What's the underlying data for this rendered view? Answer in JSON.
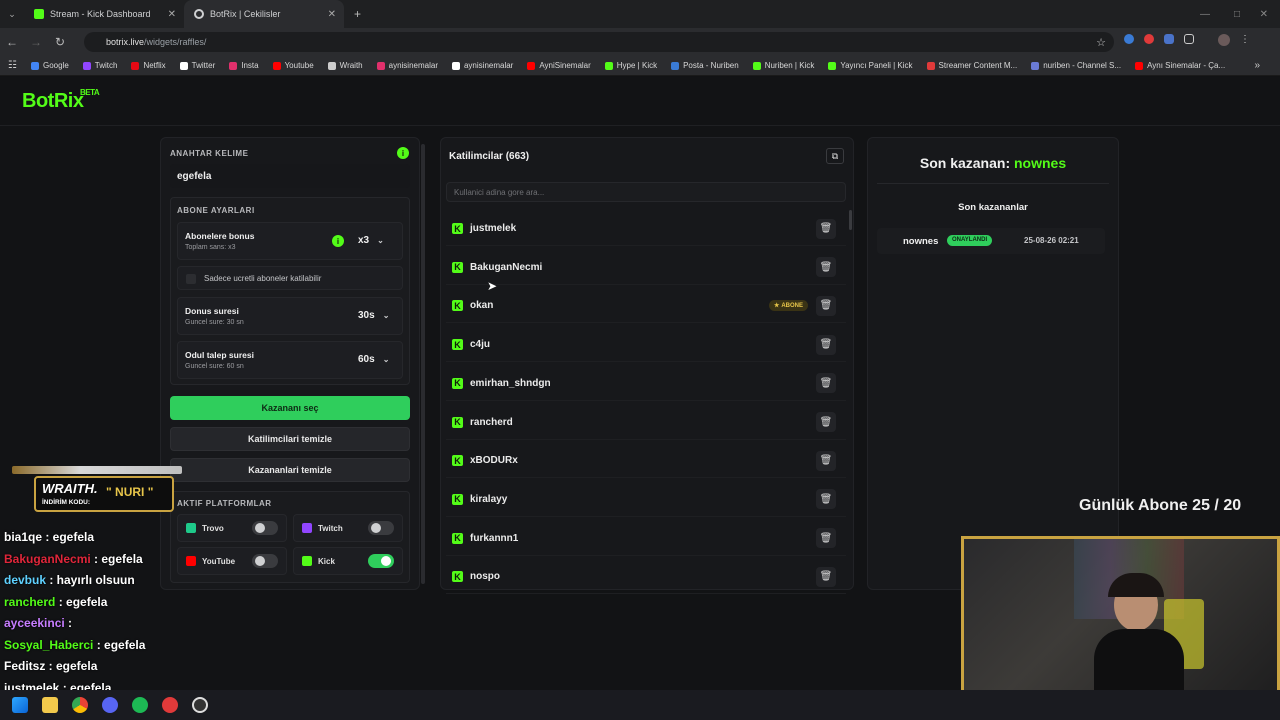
{
  "browser": {
    "tabs": [
      {
        "title": "Stream - Kick Dashboard",
        "active": false
      },
      {
        "title": "BotRix | Cekilisler",
        "active": true
      }
    ],
    "url_host": "botrix.live",
    "url_path": "/widgets/raffles/",
    "bookmarks": [
      "Google",
      "Twitch",
      "Netflix",
      "Twitter",
      "Insta",
      "Youtube",
      "Wraith",
      "aynisinemalar",
      "aynisinemalar",
      "AyniSinemalar",
      "Hype | Kick",
      "Posta - Nuriben",
      "Nuriben | Kick",
      "Yayıncı Paneli | Kick",
      "Streamer Content M...",
      "nuriben - Channel S...",
      "Aynı Sinemalar - Ça..."
    ]
  },
  "brand": {
    "name": "BotRix",
    "tag": "BETA"
  },
  "settings": {
    "keyword_title": "ANAHTAR KELIME",
    "keyword_value": "egefela",
    "sub_settings_title": "ABONE AYARLARI",
    "sub_bonus_title": "Abonelere bonus",
    "sub_bonus_sub": "Toplam sans: x3",
    "sub_bonus_value": "x3",
    "paid_only_label": "Sadece ucretli aboneler katilabilir",
    "bonus_time_title": "Donus suresi",
    "bonus_time_sub": "Guncel sure: 30 sn",
    "bonus_time_value": "30s",
    "claim_time_title": "Odul talep suresi",
    "claim_time_sub": "Guncel sure: 60 sn",
    "claim_time_value": "60s",
    "pick_winner": "Kazananı seç",
    "clear_participants": "Katilimcilari temizle",
    "clear_winners": "Kazananlari temizle",
    "platforms_title": "AKTIF PLATFORMLAR",
    "platforms": [
      {
        "name": "Trovo",
        "on": false,
        "color": "#1ec98a"
      },
      {
        "name": "Twitch",
        "on": false,
        "color": "#9146ff"
      },
      {
        "name": "YouTube",
        "on": false,
        "color": "#ff0000"
      },
      {
        "name": "Kick",
        "on": true,
        "color": "#53fc18"
      }
    ]
  },
  "participants": {
    "title": "Katilimcilar (663)",
    "search_placeholder": "Kullanici adina gore ara...",
    "sub_badge": "ABONE",
    "list": [
      "justmelek",
      "BakuganNecmi",
      "okan",
      "c4ju",
      "emirhan_shndgn",
      "rancherd",
      "xBODURx",
      "kiralayy",
      "furkannn1",
      "nospo"
    ]
  },
  "winners": {
    "last_winner_label": "Son kazanan:",
    "last_winner_name": "nownes",
    "recent_title": "Son kazananlar",
    "recent": [
      {
        "name": "nownes",
        "status": "ONAYLANDI",
        "time": "25-08-26 02:21"
      }
    ]
  },
  "overlay": {
    "sponsor_name": "WRAITH.",
    "sponsor_code_label": "İNDİRİM KODU:",
    "sponsor_code": "\" NURI \"",
    "daily_subs": "Günlük Abone 25 / 20",
    "chat": [
      {
        "user": "bia1qe",
        "msg": " : egefela",
        "color": "#ffffff"
      },
      {
        "user": "BakuganNecmi",
        "msg": " : egefela",
        "color": "#e0263a"
      },
      {
        "user": "devbuk",
        "msg": " : hayırlı olsuun",
        "color": "#5fd1ff"
      },
      {
        "user": "rancherd",
        "msg": " : egefela",
        "color": "#53fc18"
      },
      {
        "user": "ayceekinci",
        "msg": " : ",
        "color": "#c77dff"
      },
      {
        "user": "Sosyal_Haberci",
        "msg": " : egefela",
        "color": "#53fc18"
      },
      {
        "user": "Feditsz",
        "msg": " : egefela",
        "color": "#ffffff"
      },
      {
        "user": "justmelek",
        "msg": " : egefela",
        "color": "#ffffff"
      }
    ]
  }
}
